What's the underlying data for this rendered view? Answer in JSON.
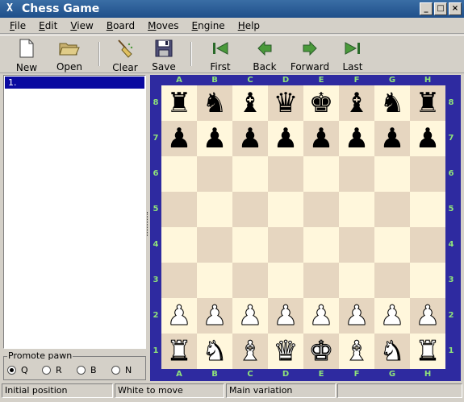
{
  "window": {
    "title": "Chess Game",
    "app_icon": "X",
    "buttons": [
      "_",
      "□",
      "×"
    ]
  },
  "menu": [
    {
      "label": "File",
      "ul": "F",
      "rest": "ile"
    },
    {
      "label": "Edit",
      "ul": "E",
      "rest": "dit"
    },
    {
      "label": "View",
      "ul": "V",
      "rest": "iew"
    },
    {
      "label": "Board",
      "ul": "B",
      "rest": "oard"
    },
    {
      "label": "Moves",
      "ul": "M",
      "rest": "oves"
    },
    {
      "label": "Engine",
      "ul": "E",
      "rest": "ngine"
    },
    {
      "label": "Help",
      "ul": "H",
      "rest": "elp"
    }
  ],
  "toolbar": {
    "new": "New",
    "open": "Open",
    "clear": "Clear",
    "save": "Save",
    "first": "First",
    "back": "Back",
    "forward": "Forward",
    "last": "Last"
  },
  "movelist": {
    "rows": [
      "1."
    ]
  },
  "promote": {
    "legend": "Promote pawn",
    "options": [
      {
        "label": "Q",
        "selected": true
      },
      {
        "label": "R",
        "selected": false
      },
      {
        "label": "B",
        "selected": false
      },
      {
        "label": "N",
        "selected": false
      }
    ]
  },
  "board": {
    "files": [
      "A",
      "B",
      "C",
      "D",
      "E",
      "F",
      "G",
      "H"
    ],
    "ranks": [
      "8",
      "7",
      "6",
      "5",
      "4",
      "3",
      "2",
      "1"
    ],
    "light_color": "#fff7dc",
    "dark_color": "#e6d6c0",
    "frame_color": "#2e2aa0",
    "label_color": "#8fe37a",
    "position": [
      [
        "bR",
        "bN",
        "bB",
        "bQ",
        "bK",
        "bB",
        "bN",
        "bR"
      ],
      [
        "bP",
        "bP",
        "bP",
        "bP",
        "bP",
        "bP",
        "bP",
        "bP"
      ],
      [
        "",
        "",
        "",
        "",
        "",
        "",
        "",
        ""
      ],
      [
        "",
        "",
        "",
        "",
        "",
        "",
        "",
        ""
      ],
      [
        "",
        "",
        "",
        "",
        "",
        "",
        "",
        ""
      ],
      [
        "",
        "",
        "",
        "",
        "",
        "",
        "",
        ""
      ],
      [
        "wP",
        "wP",
        "wP",
        "wP",
        "wP",
        "wP",
        "wP",
        "wP"
      ],
      [
        "wR",
        "wN",
        "wB",
        "wQ",
        "wK",
        "wB",
        "wN",
        "wR"
      ]
    ]
  },
  "status": {
    "position": "Initial position",
    "turn": "White to move",
    "variation": "Main variation",
    "extra": ""
  }
}
